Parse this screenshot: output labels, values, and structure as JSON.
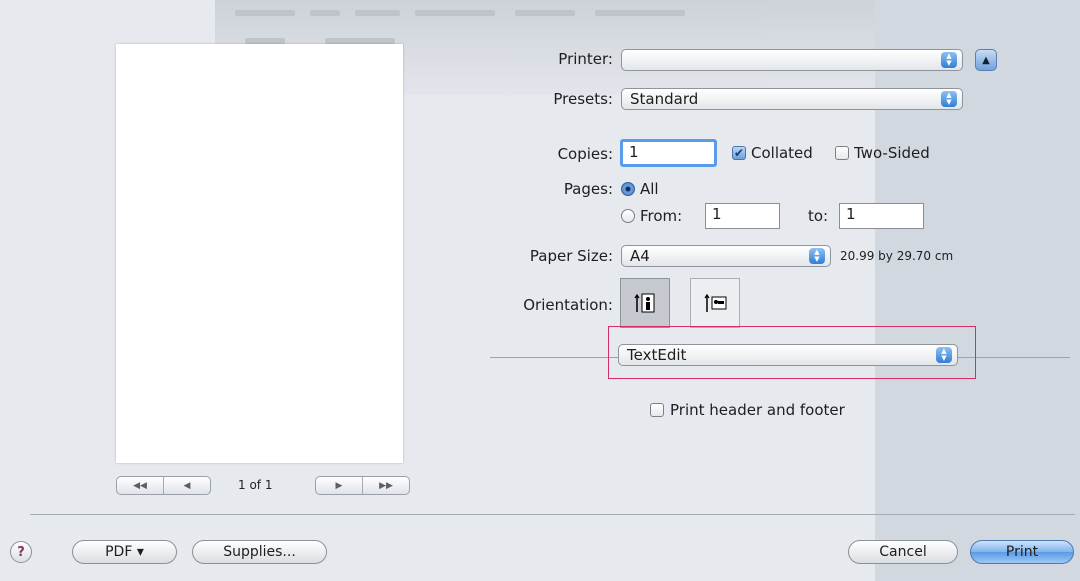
{
  "preview": {
    "page_indicator": "1 of 1",
    "first_label": "◀◀",
    "prev_label": "◀",
    "next_label": "▶",
    "last_label": "▶▶"
  },
  "printer": {
    "label": "Printer:",
    "value": ""
  },
  "presets": {
    "label": "Presets:",
    "value": "Standard"
  },
  "copies": {
    "label": "Copies:",
    "value": "1",
    "collated_label": "Collated",
    "collated_checked": true,
    "two_sided_label": "Two-Sided",
    "two_sided_checked": false
  },
  "pages": {
    "label": "Pages:",
    "all_label": "All",
    "from_label": "From:",
    "from_value": "1",
    "to_label": "to:",
    "to_value": "1",
    "selected": "All"
  },
  "paper_size": {
    "label": "Paper Size:",
    "value": "A4",
    "dimensions": "20.99 by 29.70 cm"
  },
  "orientation": {
    "label": "Orientation:",
    "selected": "portrait"
  },
  "app_menu": {
    "value": "TextEdit"
  },
  "print_header_footer": {
    "label": "Print header and footer",
    "checked": false
  },
  "footer": {
    "help_label": "?",
    "pdf_label": "PDF ▾",
    "supplies_label": "Supplies...",
    "cancel_label": "Cancel",
    "print_label": "Print"
  },
  "colors": {
    "accent": "#5a9ae6",
    "highlight": "#d32d6a"
  }
}
